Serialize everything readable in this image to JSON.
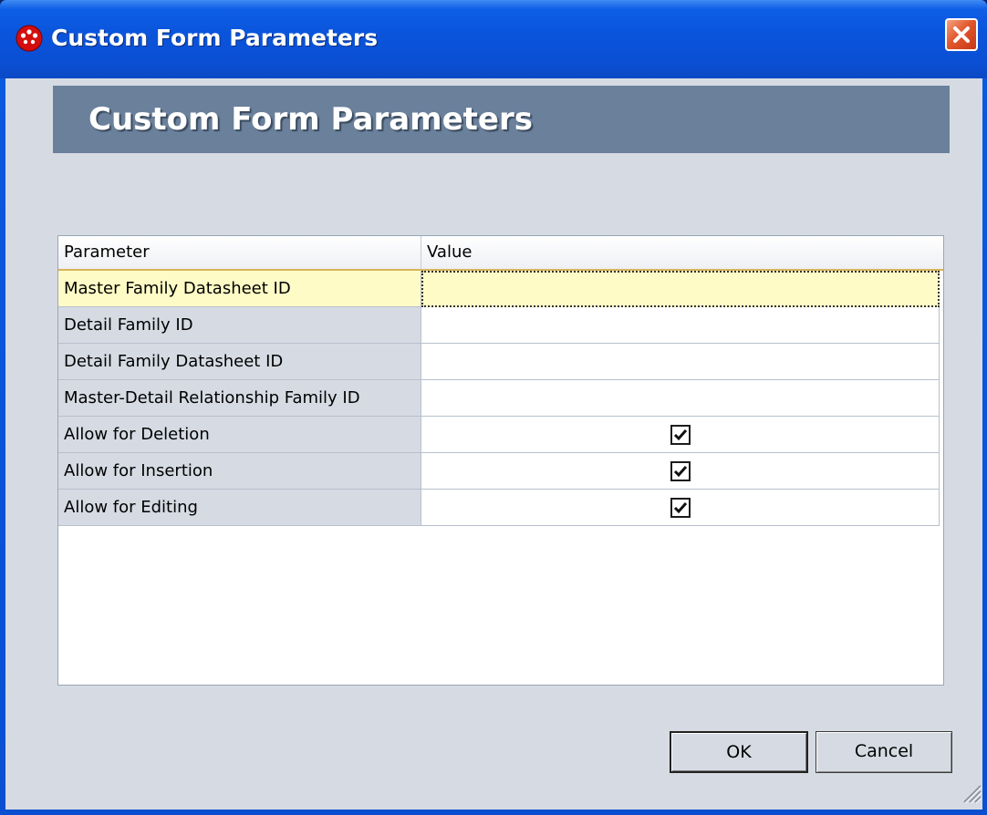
{
  "window": {
    "title": "Custom Form Parameters",
    "accent": "#0a55dc"
  },
  "banner": {
    "title": "Custom Form Parameters",
    "color": "#6a809b"
  },
  "grid": {
    "columns": [
      "Parameter",
      "Value"
    ],
    "rows": [
      {
        "parameter": "Master Family Datasheet ID",
        "value": "",
        "type": "text",
        "selected": true
      },
      {
        "parameter": "Detail Family ID",
        "value": "",
        "type": "text",
        "selected": false
      },
      {
        "parameter": "Detail Family Datasheet ID",
        "value": "",
        "type": "text",
        "selected": false
      },
      {
        "parameter": "Master-Detail Relationship Family ID",
        "value": "",
        "type": "text",
        "selected": false
      },
      {
        "parameter": "Allow for Deletion",
        "value": true,
        "type": "checkbox",
        "selected": false
      },
      {
        "parameter": "Allow for Insertion",
        "value": true,
        "type": "checkbox",
        "selected": false
      },
      {
        "parameter": "Allow for Editing",
        "value": true,
        "type": "checkbox",
        "selected": false
      }
    ]
  },
  "buttons": {
    "ok_label": "OK",
    "cancel_label": "Cancel"
  },
  "icons": {
    "app": "app-icon",
    "close": "close-icon",
    "resize": "resize-grip-icon"
  }
}
